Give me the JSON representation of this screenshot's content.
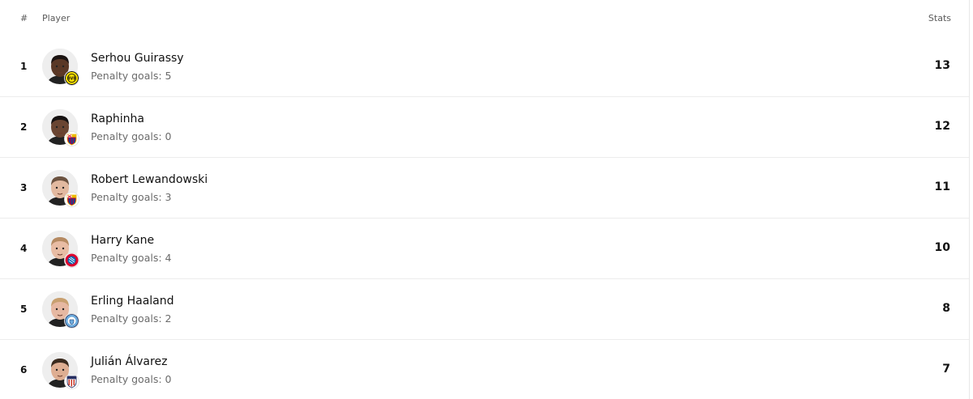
{
  "header": {
    "rank_label": "#",
    "player_label": "Player",
    "stats_label": "Stats"
  },
  "rows": [
    {
      "rank": "1",
      "name": "Serhou Guirassy",
      "subtitle": "Penalty goals: 5",
      "stat": "13",
      "club_icon": "dortmund-badge-icon",
      "skin": "#5a3826",
      "hair": "#1a1210"
    },
    {
      "rank": "2",
      "name": "Raphinha",
      "subtitle": "Penalty goals: 0",
      "stat": "12",
      "club_icon": "barcelona-badge-icon",
      "skin": "#6a4532",
      "hair": "#141010"
    },
    {
      "rank": "3",
      "name": "Robert Lewandowski",
      "subtitle": "Penalty goals: 3",
      "stat": "11",
      "club_icon": "barcelona-badge-icon",
      "skin": "#e2b9a0",
      "hair": "#6b5240"
    },
    {
      "rank": "4",
      "name": "Harry Kane",
      "subtitle": "Penalty goals: 4",
      "stat": "10",
      "club_icon": "bayern-badge-icon",
      "skin": "#e8bca4",
      "hair": "#b58a62"
    },
    {
      "rank": "5",
      "name": "Erling Haaland",
      "subtitle": "Penalty goals: 2",
      "stat": "8",
      "club_icon": "man-city-badge-icon",
      "skin": "#e6b8a2",
      "hair": "#c8a070"
    },
    {
      "rank": "6",
      "name": "Julián Álvarez",
      "subtitle": "Penalty goals: 0",
      "stat": "7",
      "club_icon": "atletico-badge-icon",
      "skin": "#deae92",
      "hair": "#3a2a1e"
    }
  ]
}
